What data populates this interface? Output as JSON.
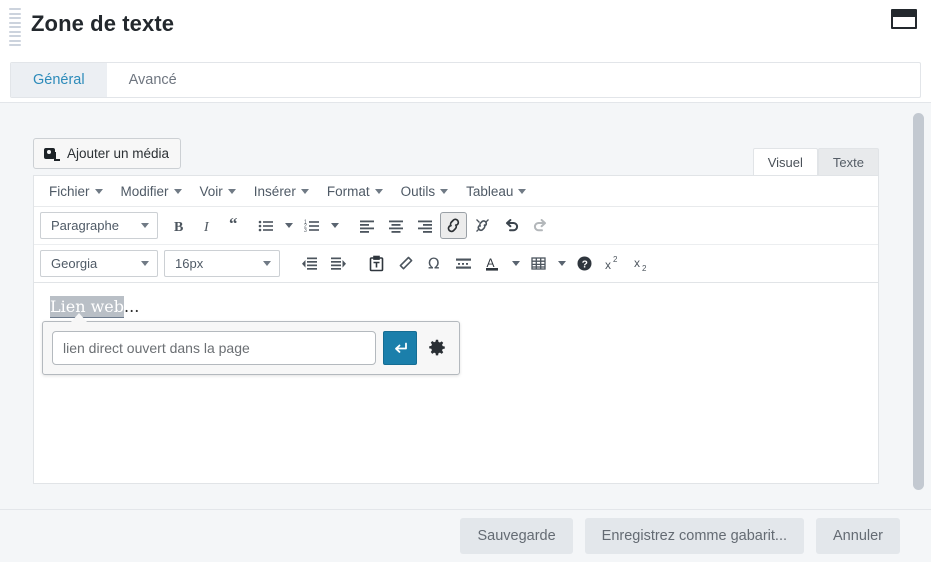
{
  "window": {
    "title": "Zone de texte",
    "drag_handle_icon": "drag-handle-icon",
    "window_icon": "window-restore-icon"
  },
  "tabs": [
    {
      "label": "Général",
      "active": true
    },
    {
      "label": "Avancé",
      "active": false
    }
  ],
  "editor": {
    "add_media_label": "Ajouter un média",
    "add_media_icon": "media-icon",
    "view_tabs": [
      {
        "label": "Visuel",
        "active": true
      },
      {
        "label": "Texte",
        "active": false
      }
    ],
    "menubar": [
      {
        "label": "Fichier"
      },
      {
        "label": "Modifier"
      },
      {
        "label": "Voir"
      },
      {
        "label": "Insérer"
      },
      {
        "label": "Format"
      },
      {
        "label": "Outils"
      },
      {
        "label": "Tableau"
      }
    ],
    "toolbar_row1": {
      "paragraph_style": "Paragraphe",
      "buttons": [
        {
          "name": "bold-icon",
          "title": "Gras"
        },
        {
          "name": "italic-icon",
          "title": "Italique"
        },
        {
          "name": "blockquote-icon",
          "title": "Citation"
        },
        {
          "name": "bullet-list-icon",
          "title": "Liste à puces"
        },
        {
          "name": "numbered-list-icon",
          "title": "Liste numérotée"
        },
        {
          "name": "align-left-icon",
          "title": "Aligner à gauche"
        },
        {
          "name": "align-center-icon",
          "title": "Centrer"
        },
        {
          "name": "align-right-icon",
          "title": "Aligner à droite"
        },
        {
          "name": "link-icon",
          "title": "Insérer/modifier un lien",
          "active": true
        },
        {
          "name": "unlink-icon",
          "title": "Supprimer le lien"
        },
        {
          "name": "undo-icon",
          "title": "Annuler"
        },
        {
          "name": "redo-icon",
          "title": "Rétablir",
          "disabled": true
        }
      ]
    },
    "toolbar_row2": {
      "font_family": "Georgia",
      "font_size": "16px",
      "buttons": [
        {
          "name": "outdent-icon",
          "title": "Diminuer le retrait"
        },
        {
          "name": "indent-icon",
          "title": "Augmenter le retrait"
        },
        {
          "name": "paste-as-text-icon",
          "title": "Coller en texte"
        },
        {
          "name": "clear-formatting-icon",
          "title": "Effacer la mise en forme"
        },
        {
          "name": "special-character-icon",
          "title": "Caractère spécial",
          "glyph": "Ω"
        },
        {
          "name": "horizontal-rule-icon",
          "title": "Ligne horizontale"
        },
        {
          "name": "text-color-icon",
          "title": "Couleur du texte",
          "glyph": "A"
        },
        {
          "name": "table-icon",
          "title": "Tableau"
        },
        {
          "name": "help-icon",
          "title": "Aide",
          "glyph": "?"
        },
        {
          "name": "superscript-icon",
          "title": "Exposant",
          "glyph": "x²"
        },
        {
          "name": "subscript-icon",
          "title": "Indice",
          "glyph": "x₂"
        }
      ]
    },
    "content": {
      "selected_text": "Lien web",
      "trailing_text": "..."
    },
    "link_popup": {
      "url_placeholder": "lien direct ouvert dans la page",
      "url_value": "",
      "apply_icon": "enter-arrow-icon",
      "apply_color": "#1b7fab",
      "settings_icon": "gear-icon"
    }
  },
  "footer": {
    "buttons": [
      {
        "label": "Sauvegarde",
        "name": "save-button"
      },
      {
        "label": "Enregistrez comme gabarit...",
        "name": "save-as-template-button"
      },
      {
        "label": "Annuler",
        "name": "cancel-button"
      }
    ]
  },
  "scrollbar": {
    "name": "vertical-scrollbar"
  },
  "colors": {
    "accent": "#2d8bba",
    "panel_bg": "#f4f6f8",
    "border": "#e1e4e7",
    "apply_blue": "#1b7fab"
  }
}
